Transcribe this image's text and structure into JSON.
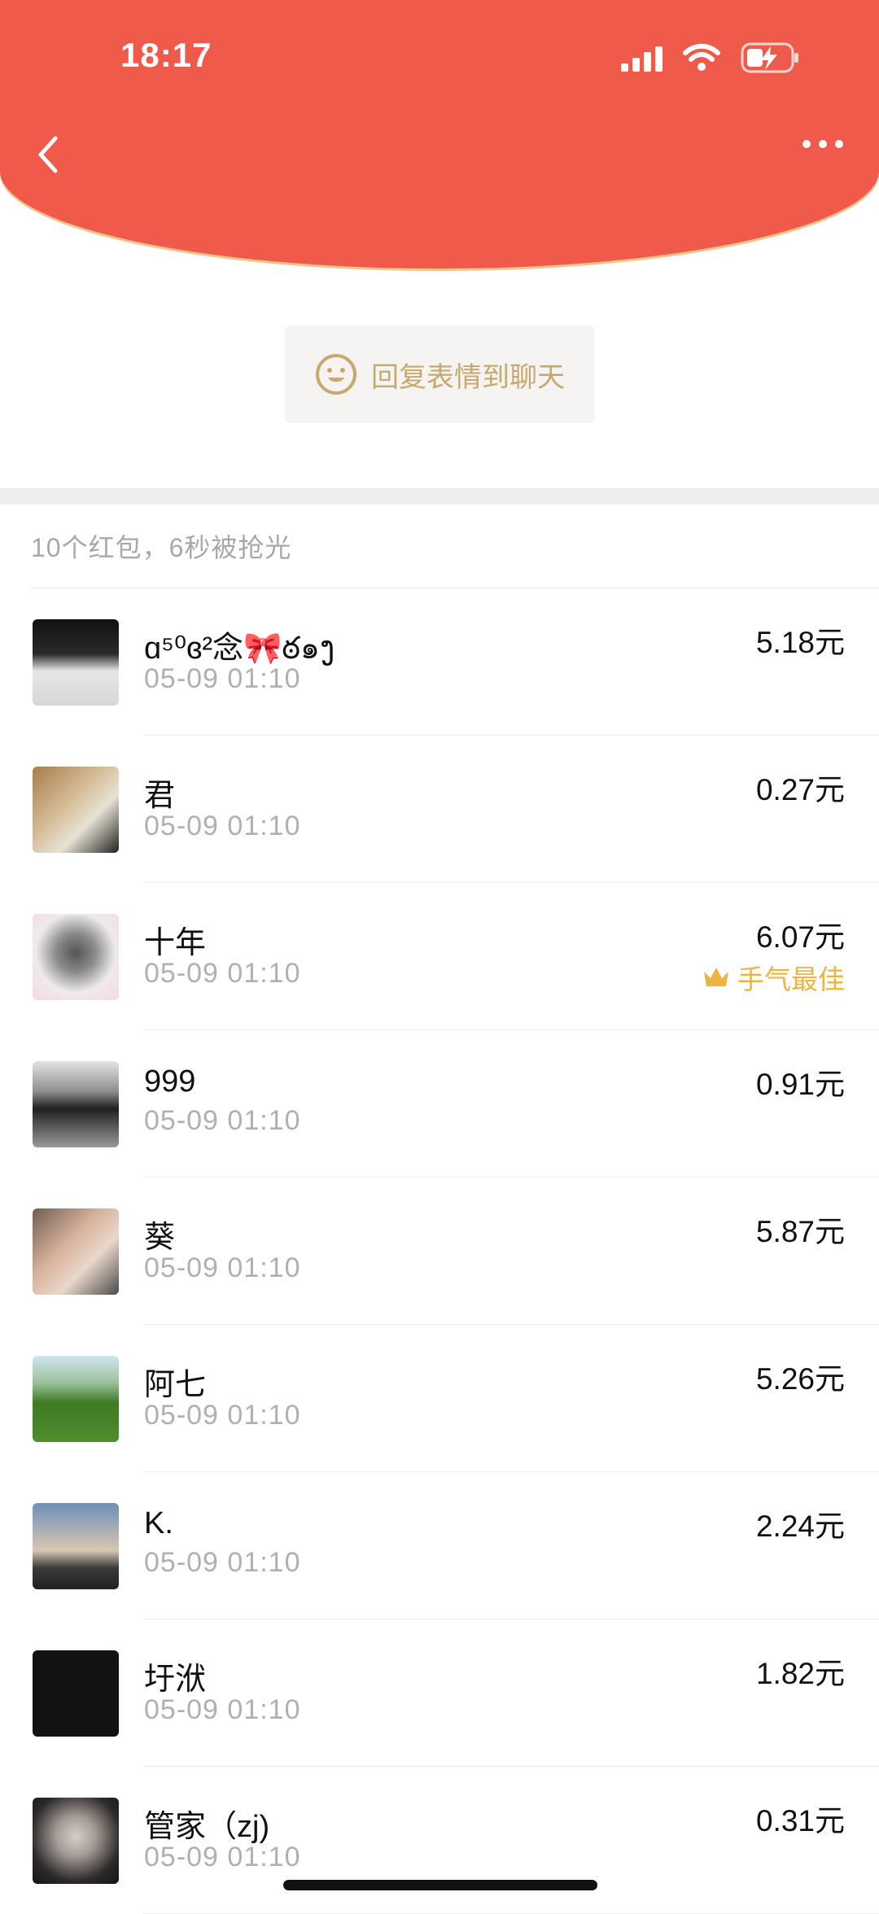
{
  "status_bar": {
    "time": "18:17"
  },
  "header": {
    "back_icon": "chevron-left-icon",
    "more_icon": "ellipsis-icon"
  },
  "reply": {
    "label": "回复表情到聊天",
    "icon": "smile-icon"
  },
  "summary": "10个红包，6秒被抢光",
  "records": [
    {
      "name": "ɑ⁵⁰ɞ²念🎀ఠ๑ງ",
      "time": "05-09 01:10",
      "amount": "5.18元",
      "avatar_color": "#1a1a1a"
    },
    {
      "name": "君",
      "time": "05-09 01:10",
      "amount": "0.27元",
      "avatar_color": "#c9a882"
    },
    {
      "name": "十年",
      "time": "05-09 01:10",
      "amount": "6.07元",
      "best": "手气最佳",
      "avatar_color": "#d9d5d4"
    },
    {
      "name": "999",
      "time": "05-09 01:10",
      "amount": "0.91元",
      "avatar_color": "#a8a8a8"
    },
    {
      "name": "葵",
      "time": "05-09 01:10",
      "amount": "5.87元",
      "avatar_color": "#b79a8b"
    },
    {
      "name": "阿七",
      "time": "05-09 01:10",
      "amount": "5.26元",
      "avatar_color": "#5c8d3a"
    },
    {
      "name": "K.",
      "time": "05-09 01:10",
      "amount": "2.24元",
      "avatar_color": "#7c8fa6"
    },
    {
      "name": "圩洑",
      "time": "05-09 01:10",
      "amount": "1.82元",
      "avatar_color": "#121212"
    },
    {
      "name": "管家（zj)",
      "time": "05-09 01:10",
      "amount": "0.31元",
      "avatar_color": "#8d8b89"
    }
  ],
  "colors": {
    "header_red": "#ef5a4a",
    "gold": "#c9a86c",
    "best_gold": "#efb341"
  }
}
